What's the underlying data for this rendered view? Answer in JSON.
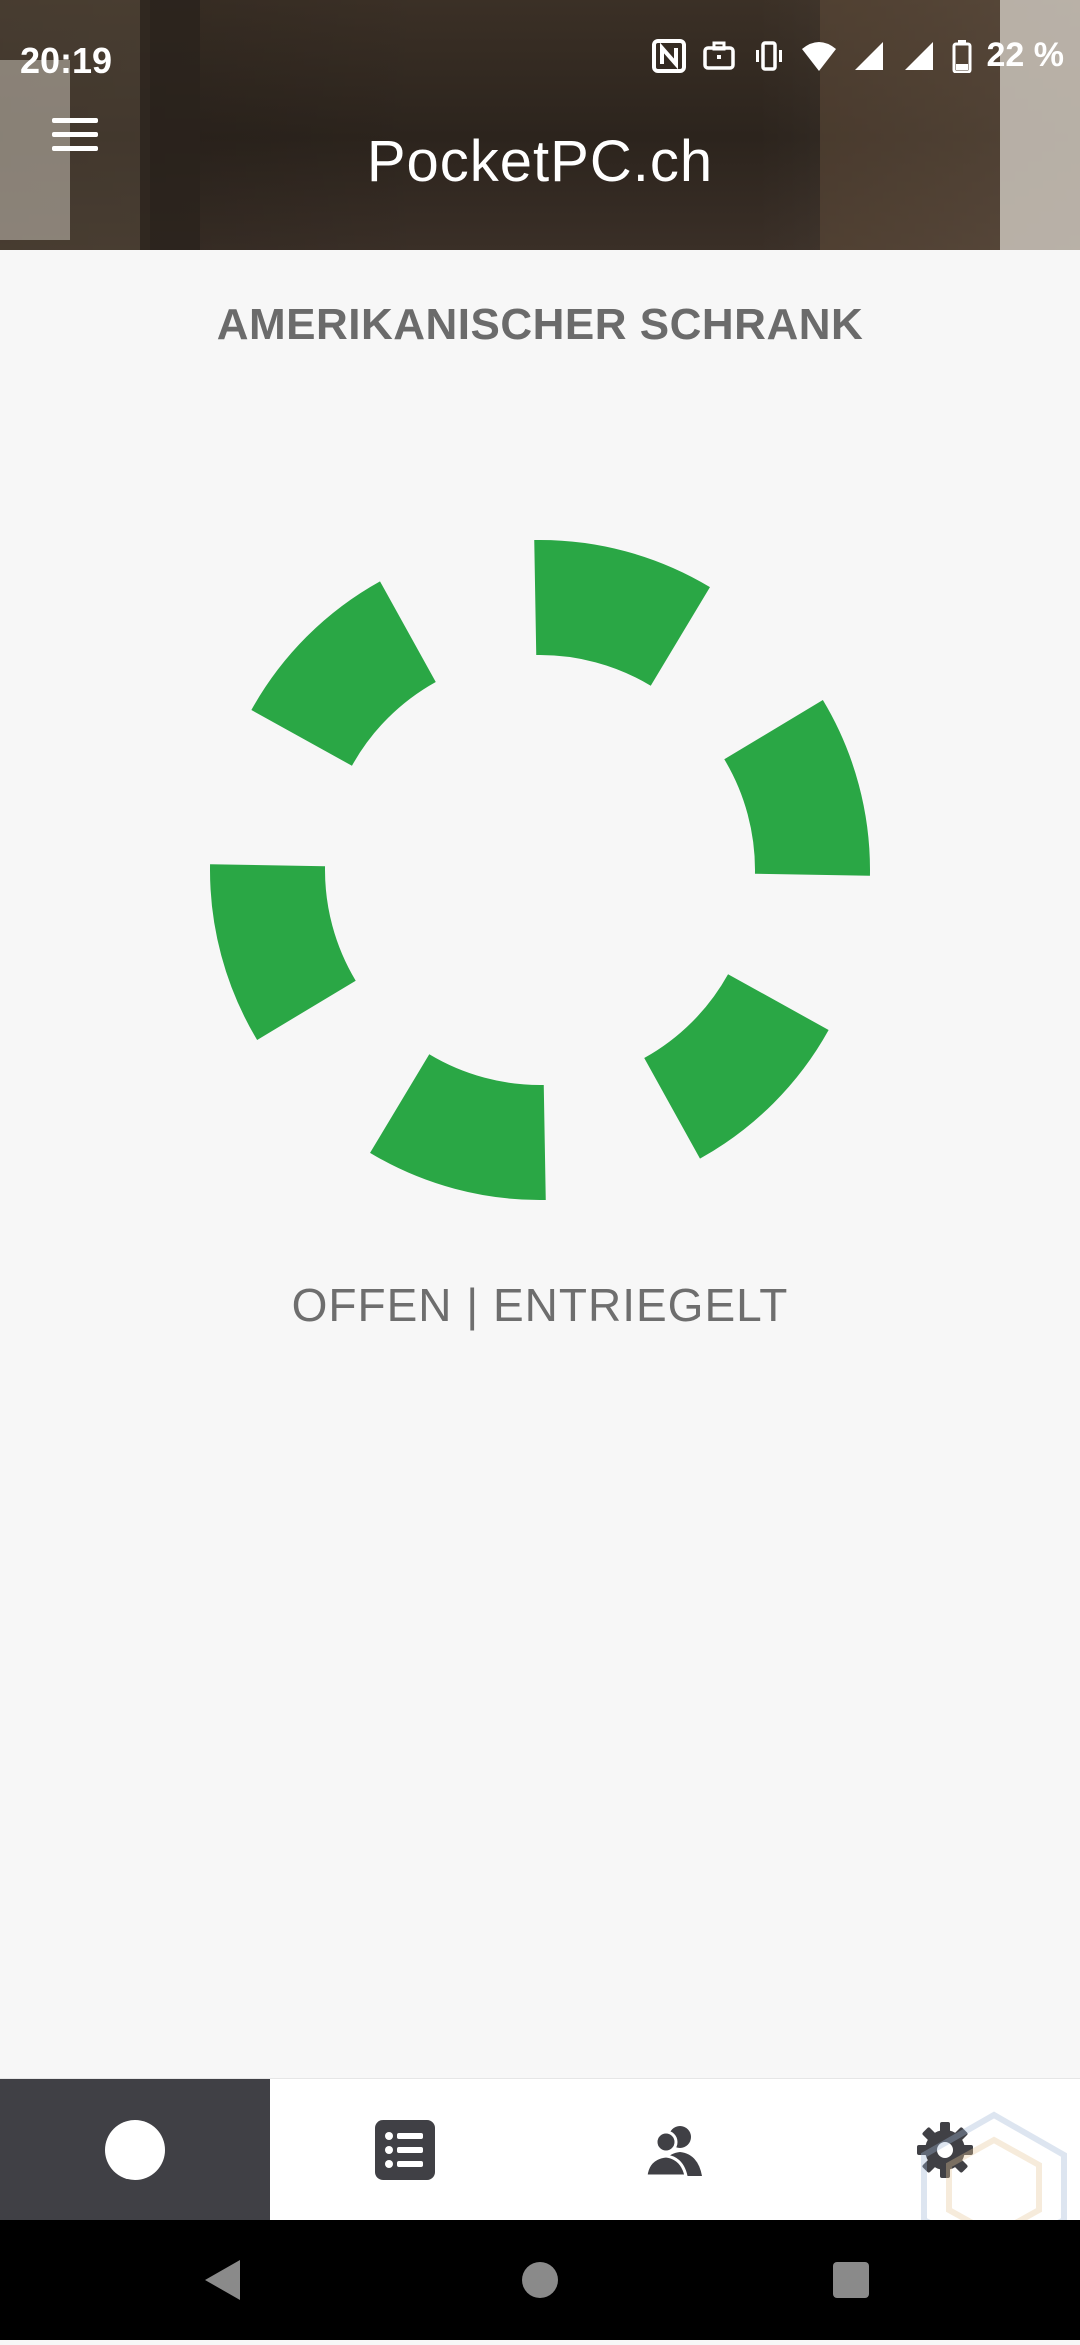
{
  "status_bar": {
    "time": "20:19",
    "battery": "22 %",
    "icons": [
      "nfc-icon",
      "work-profile-icon",
      "vibrate-icon",
      "wifi-icon",
      "signal-icon",
      "signal-icon",
      "battery-icon"
    ]
  },
  "header": {
    "title": "PocketPC.ch",
    "menu_icon": "hamburger-menu-icon"
  },
  "device": {
    "name": "AMERIKANISCHER SCHRANK",
    "status": "OFFEN | ENTRIEGELT",
    "ring_color": "#2aa745",
    "ring_segments": 6
  },
  "bottom_nav": {
    "items": [
      {
        "icon": "circle-icon",
        "active": true
      },
      {
        "icon": "list-icon",
        "active": false
      },
      {
        "icon": "users-icon",
        "active": false
      },
      {
        "icon": "gear-icon",
        "active": false
      }
    ]
  }
}
